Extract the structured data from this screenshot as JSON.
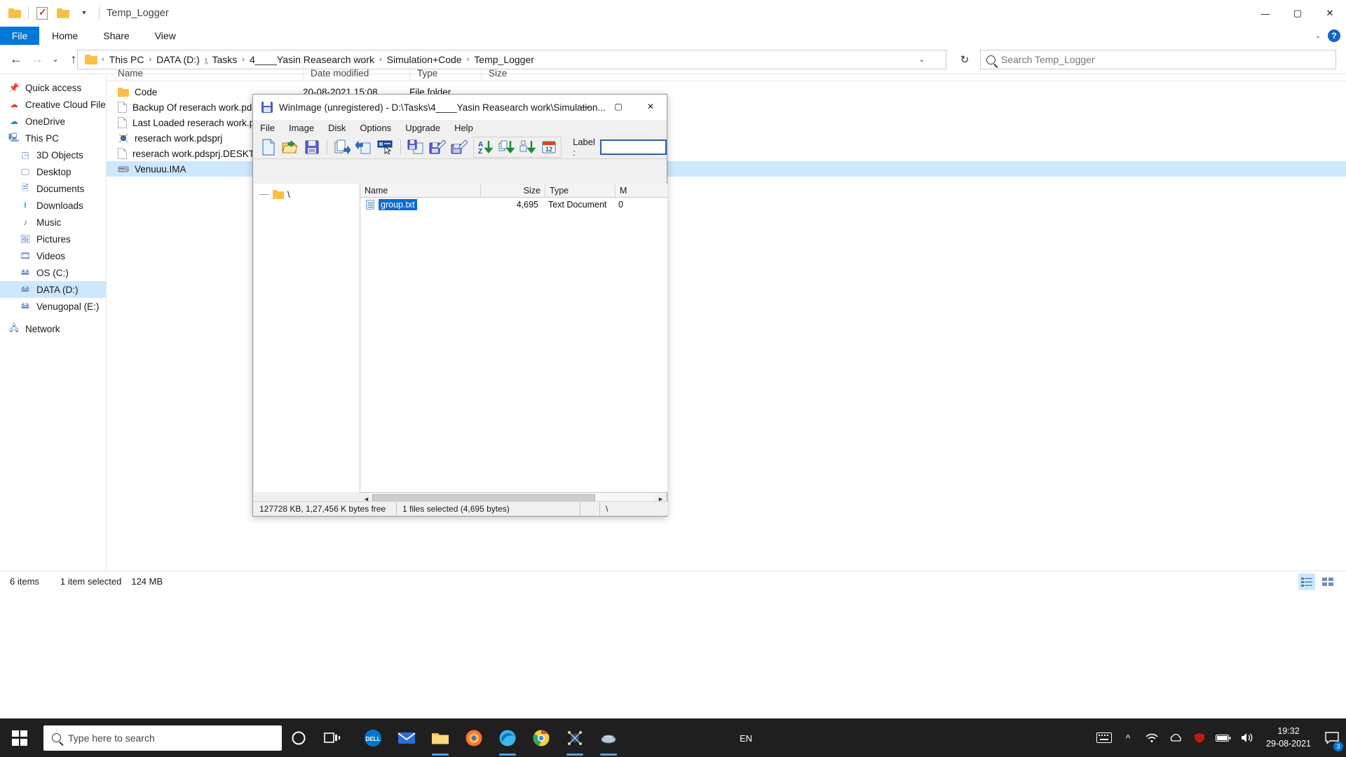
{
  "explorer": {
    "window_title": "Temp_Logger",
    "quick_access_icons": [
      "folder-icon",
      "properties-icon",
      "new-folder-icon",
      "customize-chevron-icon"
    ],
    "caption_buttons": {
      "minimize": "—",
      "maximize": "▢",
      "close": "✕"
    },
    "ribbon": {
      "file_tab": "File",
      "tabs": [
        "Home",
        "Share",
        "View"
      ],
      "collapse_caret": "⌄",
      "help": "?"
    },
    "address": {
      "back": "←",
      "forward": "→",
      "recent": "⌄",
      "up": "↑",
      "crumbs": [
        "This PC",
        "DATA (D:)",
        "Tasks",
        "4____Yasin Reasearch work",
        "Simulation+Code",
        "Temp_Logger"
      ],
      "dropdown_caret": "⌄",
      "refresh": "↻"
    },
    "search": {
      "placeholder": "Search Temp_Logger",
      "icon": "search-icon"
    },
    "navpane": [
      {
        "label": "Quick access",
        "icon": "pin-icon",
        "indent": false,
        "selected": false
      },
      {
        "label": "Creative Cloud Files",
        "icon": "cloud-icon",
        "indent": false,
        "selected": false
      },
      {
        "label": "OneDrive",
        "icon": "onedrive-icon",
        "indent": false,
        "selected": false
      },
      {
        "label": "This PC",
        "icon": "pc-icon",
        "indent": false,
        "selected": false
      },
      {
        "label": "3D Objects",
        "icon": "3d-objects-icon",
        "indent": true,
        "selected": false
      },
      {
        "label": "Desktop",
        "icon": "desktop-icon",
        "indent": true,
        "selected": false
      },
      {
        "label": "Documents",
        "icon": "documents-icon",
        "indent": true,
        "selected": false
      },
      {
        "label": "Downloads",
        "icon": "downloads-icon",
        "indent": true,
        "selected": false
      },
      {
        "label": "Music",
        "icon": "music-icon",
        "indent": true,
        "selected": false
      },
      {
        "label": "Pictures",
        "icon": "pictures-icon",
        "indent": true,
        "selected": false
      },
      {
        "label": "Videos",
        "icon": "videos-icon",
        "indent": true,
        "selected": false
      },
      {
        "label": "OS (C:)",
        "icon": "drive-icon",
        "indent": true,
        "selected": false
      },
      {
        "label": "DATA (D:)",
        "icon": "drive-icon",
        "indent": true,
        "selected": true
      },
      {
        "label": "Venugopal (E:)",
        "icon": "drive-icon",
        "indent": true,
        "selected": false
      },
      {
        "label": "Network",
        "icon": "network-icon",
        "indent": false,
        "selected": false
      }
    ],
    "columns": [
      {
        "label": "Name",
        "sorted": true
      },
      {
        "label": "Date modified",
        "sorted": false
      },
      {
        "label": "Type",
        "sorted": false
      },
      {
        "label": "Size",
        "sorted": false
      }
    ],
    "rows": [
      {
        "name": "Code",
        "icon": "folder-icon",
        "date": "20-08-2021 15:08",
        "type": "File folder",
        "size": "",
        "selected": false
      },
      {
        "name": "Backup Of reserach work.pdsbak",
        "icon": "document-icon",
        "date": "",
        "type": "",
        "size": "",
        "selected": false
      },
      {
        "name": "Last Loaded reserach work.pdsbak",
        "icon": "document-icon",
        "date": "",
        "type": "",
        "size": "",
        "selected": false
      },
      {
        "name": "reserach work.pdsprj",
        "icon": "proteus-project-icon",
        "date": "",
        "type": "",
        "size": "",
        "selected": false
      },
      {
        "name": "reserach work.pdsprj.DESKTOP-",
        "icon": "document-icon",
        "date": "",
        "type": "",
        "size": "",
        "selected": false
      },
      {
        "name": "Venuuu.IMA",
        "icon": "disk-image-icon",
        "date": "",
        "type": "",
        "size": "",
        "selected": true
      }
    ],
    "statusbar": {
      "items_count": "6 items",
      "selected_info": "1 item selected",
      "selected_size": "124 MB",
      "view_buttons": [
        "details-view-icon",
        "large-icons-view-icon"
      ]
    }
  },
  "winimage": {
    "title": "WinImage (unregistered) - D:\\Tasks\\4____Yasin Reasearch work\\Simulation...",
    "title_icon": "floppy-save-icon",
    "caption_buttons": {
      "minimize": "—",
      "maximize": "▢",
      "close": "✕"
    },
    "menu": [
      "File",
      "Image",
      "Disk",
      "Options",
      "Upgrade",
      "Help"
    ],
    "toolbar": [
      {
        "name": "new-image-icon",
        "group": 0
      },
      {
        "name": "open-image-icon",
        "group": 0
      },
      {
        "name": "save-image-icon",
        "group": 0
      },
      {
        "name": "extract-icon",
        "group": 1
      },
      {
        "name": "inject-icon",
        "group": 1
      },
      {
        "name": "select-all-icon",
        "group": 1
      },
      {
        "name": "read-disk-icon",
        "group": 2
      },
      {
        "name": "write-disk-icon",
        "group": 2
      },
      {
        "name": "format-write-disk-icon",
        "group": 2
      },
      {
        "name": "sort-by-name-icon",
        "group": 3
      },
      {
        "name": "sort-by-type-icon",
        "group": 3
      },
      {
        "name": "sort-by-size-icon",
        "group": 3
      },
      {
        "name": "sort-by-date-icon",
        "group": 3
      }
    ],
    "label": {
      "caption": "Label :",
      "value": "",
      "placeholder": ""
    },
    "tree": {
      "root": "\\",
      "icon": "folder-icon"
    },
    "columns": [
      "Name",
      "Size",
      "Type",
      "M"
    ],
    "rows": [
      {
        "name": "group.txt",
        "icon": "text-file-icon",
        "size": "4,695",
        "type": "Text Document",
        "modified": "0",
        "selected": true
      }
    ],
    "hscroll": {
      "left_arrow": "◄",
      "right_arrow": "►"
    },
    "status": {
      "disk_info": "127728 KB, 1,27,456 K bytes free",
      "selection": "1 files selected (4,695 bytes)",
      "spare": "",
      "path": "\\"
    }
  },
  "taskbar": {
    "start": "windows-logo-icon",
    "search_placeholder": "Type here to search",
    "search_icon": "search-icon",
    "cortana_icon": "cortana-icon",
    "taskview_icon": "task-view-icon",
    "pinned": [
      {
        "name": "dell-icon",
        "label": "DELL",
        "open": false
      },
      {
        "name": "mail-icon",
        "label": "",
        "open": false
      },
      {
        "name": "file-explorer-icon",
        "label": "",
        "open": true
      },
      {
        "name": "firefox-icon",
        "label": "",
        "open": false
      },
      {
        "name": "edge-icon",
        "label": "",
        "open": true
      },
      {
        "name": "chrome-icon",
        "label": "",
        "open": false
      },
      {
        "name": "proteus-icon",
        "label": "",
        "open": true
      },
      {
        "name": "winimage-icon",
        "label": "",
        "open": true
      }
    ],
    "language": "EN",
    "tray": [
      "keyboard-icon",
      "show-hidden-icon",
      "wifi-icon",
      "onedrive-tray-icon",
      "mcafee-icon",
      "battery-icon",
      "volume-icon"
    ],
    "clock_time": "19:32",
    "clock_date": "29-08-2021",
    "action_center_icon": "action-center-icon",
    "notification_count": "3"
  }
}
